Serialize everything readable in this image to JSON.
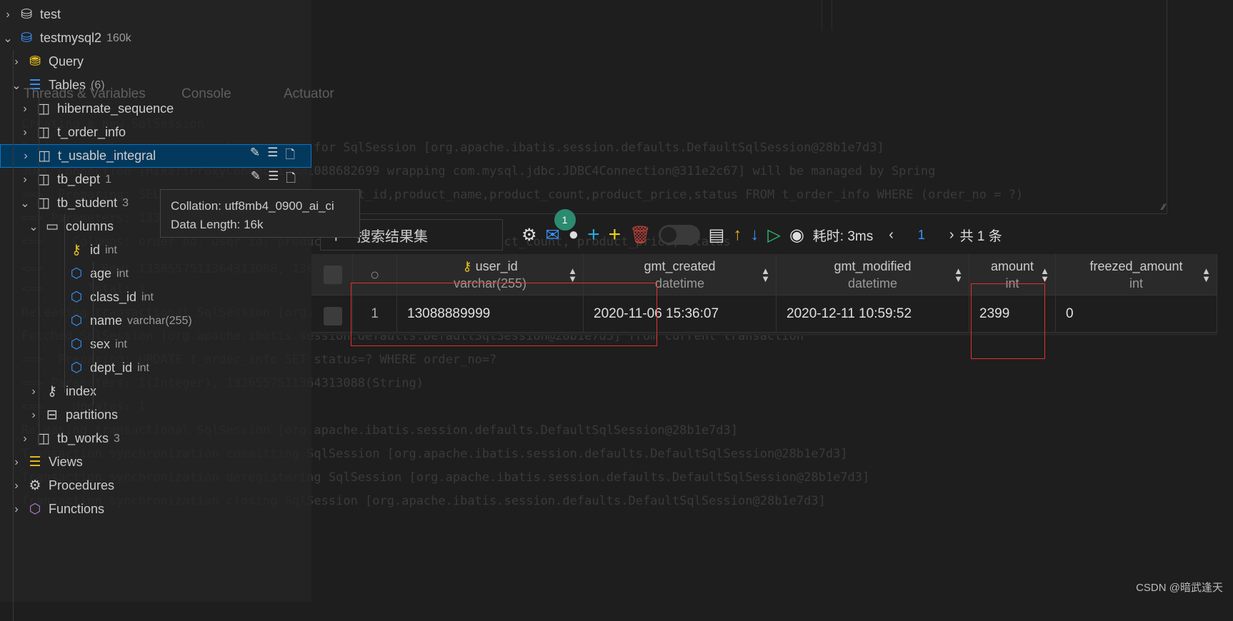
{
  "sidebar": {
    "items": [
      {
        "label": "test",
        "sub": "",
        "chevron": "right",
        "icon": "database-icon"
      },
      {
        "label": "testmysql2",
        "sub": "160k",
        "chevron": "down",
        "icon": "database-icon"
      },
      {
        "label": "Query",
        "sub": "",
        "chevron": "right",
        "icon": "coins-icon"
      },
      {
        "label": "Tables",
        "sub": "(6)",
        "chevron": "down",
        "icon": "list-icon"
      },
      {
        "label": "hibernate_sequence",
        "sub": "",
        "chevron": "right",
        "icon": "table-icon"
      },
      {
        "label": "t_order_info",
        "sub": "",
        "chevron": "right",
        "icon": "table-icon"
      },
      {
        "label": "t_usable_integral",
        "sub": "",
        "chevron": "right",
        "icon": "table-icon",
        "selected": true
      },
      {
        "label": "tb_dept",
        "sub": "1",
        "chevron": "right",
        "icon": "table-icon"
      },
      {
        "label": "tb_student",
        "sub": "3",
        "chevron": "down",
        "icon": "table-icon"
      },
      {
        "label": "columns",
        "sub": "",
        "chevron": "down",
        "icon": "columns-icon"
      },
      {
        "label": "id",
        "sub": "int",
        "chevron": "",
        "icon": "key-icon"
      },
      {
        "label": "age",
        "sub": "int",
        "chevron": "",
        "icon": "cube-icon"
      },
      {
        "label": "class_id",
        "sub": "int",
        "chevron": "",
        "icon": "cube-icon"
      },
      {
        "label": "name",
        "sub": "varchar(255)",
        "chevron": "",
        "icon": "cube-icon"
      },
      {
        "label": "sex",
        "sub": "int",
        "chevron": "",
        "icon": "cube-icon"
      },
      {
        "label": "dept_id",
        "sub": "int",
        "chevron": "",
        "icon": "cube-icon"
      },
      {
        "label": "index",
        "sub": "",
        "chevron": "right",
        "icon": "index-key-icon"
      },
      {
        "label": "partitions",
        "sub": "",
        "chevron": "right",
        "icon": "partitions-icon"
      },
      {
        "label": "tb_works",
        "sub": "3",
        "chevron": "right",
        "icon": "table-icon"
      },
      {
        "label": "Views",
        "sub": "",
        "chevron": "right",
        "icon": "views-icon"
      },
      {
        "label": "Procedures",
        "sub": "",
        "chevron": "right",
        "icon": "gear-icon"
      },
      {
        "label": "Functions",
        "sub": "",
        "chevron": "right",
        "icon": "function-cube-icon"
      }
    ]
  },
  "tooltip": {
    "collation": "Collation: utf8mb4_0900_ai_ci",
    "data_length": "Data Length: 16k"
  },
  "log": {
    "tabs": [
      "Threads & Variables",
      "Console",
      "Actuator"
    ],
    "lines": [
      "Creating a new SqlSession",
      "Registering transaction synchronization for SqlSession [org.apache.ibatis.session.defaults.DefaultSqlSession@28b1e7d3]",
      "JDBC Connection [HikariProxyConnection@1088682699 wrapping com.mysql.jdbc.JDBC4Connection@311e2c67] will be managed by Spring",
      "==>  Preparing: SELECT order_no,user_id,product_id,product_name,product_count,product_price,status FROM t_order_info WHERE (order_no = ?)",
      "==> Parameters: 1336557511364313088(String)",
      "<==    Columns: order_no, user_id, product_id, product_name, product_count, product_price, status",
      "<==        Row: 1336557511364313088, 13088889999, 1, 测试商品, 1, 2399, 0",
      "<==      Total: 1",
      "Releasing transactional SqlSession [org.apache.ibatis.session.defaults.DefaultSqlSession@28b1e7d3]",
      "Fetched SqlSession [org.apache.ibatis.session.defaults.DefaultSqlSession@28b1e7d3] from current transaction",
      "==>  Preparing: UPDATE t_order_info SET status=? WHERE order_no=?",
      "==> Parameters: 1(Integer), 1336557511364313088(String)",
      "<==    Updates: 1",
      "Releasing transactional SqlSession [org.apache.ibatis.session.defaults.DefaultSqlSession@28b1e7d3]",
      "Transaction synchronization committing SqlSession [org.apache.ibatis.session.defaults.DefaultSqlSession@28b1e7d3]",
      "Transaction synchronization deregistering SqlSession [org.apache.ibatis.session.defaults.DefaultSqlSession@28b1e7d3]",
      "Transaction synchronization closing SqlSession [org.apache.ibatis.session.defaults.DefaultSqlSession@28b1e7d3]"
    ]
  },
  "toolbar": {
    "search_placeholder": "搜索结果集",
    "notification_count": "1",
    "elapsed": "耗时: 3ms",
    "page": "1",
    "total": "共 1 条"
  },
  "grid": {
    "columns": [
      {
        "name": "user_id",
        "type": "varchar(255)",
        "primary_key": true
      },
      {
        "name": "gmt_created",
        "type": "datetime"
      },
      {
        "name": "gmt_modified",
        "type": "datetime"
      },
      {
        "name": "amount",
        "type": "int"
      },
      {
        "name": "freezed_amount",
        "type": "int"
      }
    ],
    "rows": [
      {
        "index": "1",
        "values": [
          "13088889999",
          "2020-11-06 15:36:07",
          "2020-12-11 10:59:52",
          "2399",
          "0"
        ]
      }
    ]
  },
  "colors": {
    "selection": "#04395e",
    "accent_blue": "#3794ff",
    "key_yellow": "#e2c08d",
    "highlight_red": "#e03030",
    "badge_green": "#2c8a6e"
  },
  "watermark": "CSDN @暗武逢天"
}
